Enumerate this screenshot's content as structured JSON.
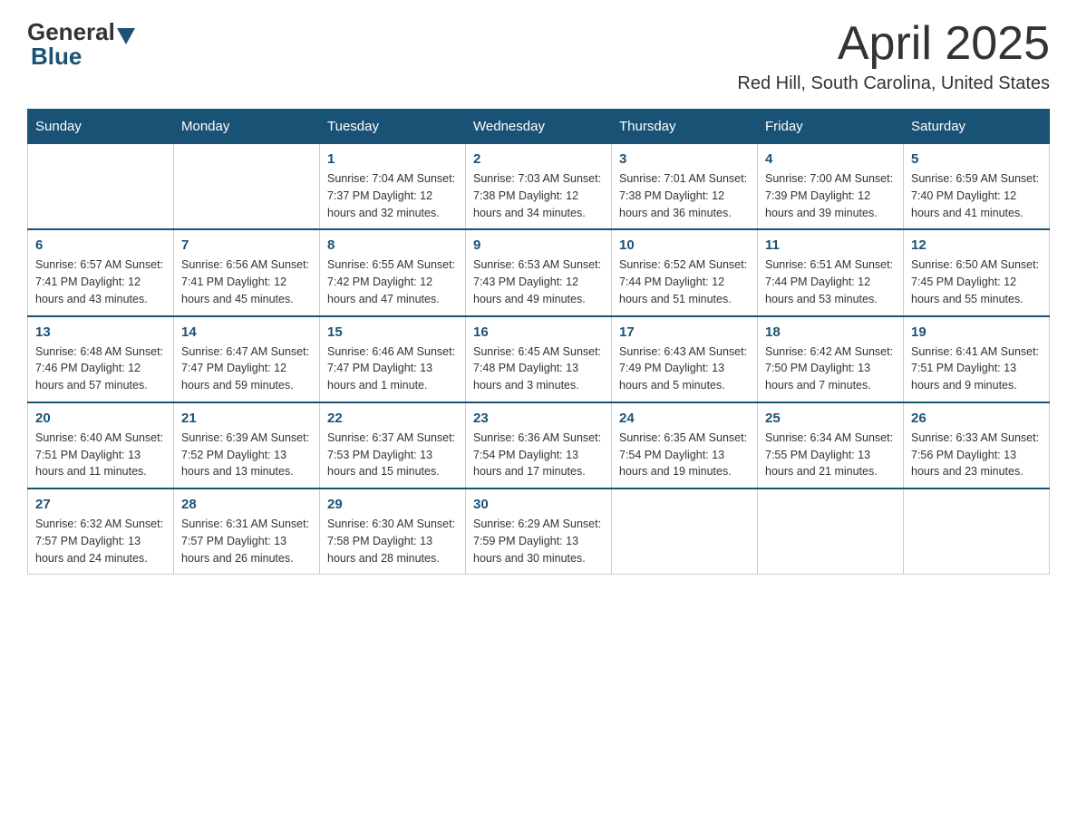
{
  "header": {
    "logo_general": "General",
    "logo_blue": "Blue",
    "title": "April 2025",
    "location": "Red Hill, South Carolina, United States"
  },
  "days_of_week": [
    "Sunday",
    "Monday",
    "Tuesday",
    "Wednesday",
    "Thursday",
    "Friday",
    "Saturday"
  ],
  "weeks": [
    [
      {
        "day": "",
        "info": ""
      },
      {
        "day": "",
        "info": ""
      },
      {
        "day": "1",
        "info": "Sunrise: 7:04 AM\nSunset: 7:37 PM\nDaylight: 12 hours\nand 32 minutes."
      },
      {
        "day": "2",
        "info": "Sunrise: 7:03 AM\nSunset: 7:38 PM\nDaylight: 12 hours\nand 34 minutes."
      },
      {
        "day": "3",
        "info": "Sunrise: 7:01 AM\nSunset: 7:38 PM\nDaylight: 12 hours\nand 36 minutes."
      },
      {
        "day": "4",
        "info": "Sunrise: 7:00 AM\nSunset: 7:39 PM\nDaylight: 12 hours\nand 39 minutes."
      },
      {
        "day": "5",
        "info": "Sunrise: 6:59 AM\nSunset: 7:40 PM\nDaylight: 12 hours\nand 41 minutes."
      }
    ],
    [
      {
        "day": "6",
        "info": "Sunrise: 6:57 AM\nSunset: 7:41 PM\nDaylight: 12 hours\nand 43 minutes."
      },
      {
        "day": "7",
        "info": "Sunrise: 6:56 AM\nSunset: 7:41 PM\nDaylight: 12 hours\nand 45 minutes."
      },
      {
        "day": "8",
        "info": "Sunrise: 6:55 AM\nSunset: 7:42 PM\nDaylight: 12 hours\nand 47 minutes."
      },
      {
        "day": "9",
        "info": "Sunrise: 6:53 AM\nSunset: 7:43 PM\nDaylight: 12 hours\nand 49 minutes."
      },
      {
        "day": "10",
        "info": "Sunrise: 6:52 AM\nSunset: 7:44 PM\nDaylight: 12 hours\nand 51 minutes."
      },
      {
        "day": "11",
        "info": "Sunrise: 6:51 AM\nSunset: 7:44 PM\nDaylight: 12 hours\nand 53 minutes."
      },
      {
        "day": "12",
        "info": "Sunrise: 6:50 AM\nSunset: 7:45 PM\nDaylight: 12 hours\nand 55 minutes."
      }
    ],
    [
      {
        "day": "13",
        "info": "Sunrise: 6:48 AM\nSunset: 7:46 PM\nDaylight: 12 hours\nand 57 minutes."
      },
      {
        "day": "14",
        "info": "Sunrise: 6:47 AM\nSunset: 7:47 PM\nDaylight: 12 hours\nand 59 minutes."
      },
      {
        "day": "15",
        "info": "Sunrise: 6:46 AM\nSunset: 7:47 PM\nDaylight: 13 hours\nand 1 minute."
      },
      {
        "day": "16",
        "info": "Sunrise: 6:45 AM\nSunset: 7:48 PM\nDaylight: 13 hours\nand 3 minutes."
      },
      {
        "day": "17",
        "info": "Sunrise: 6:43 AM\nSunset: 7:49 PM\nDaylight: 13 hours\nand 5 minutes."
      },
      {
        "day": "18",
        "info": "Sunrise: 6:42 AM\nSunset: 7:50 PM\nDaylight: 13 hours\nand 7 minutes."
      },
      {
        "day": "19",
        "info": "Sunrise: 6:41 AM\nSunset: 7:51 PM\nDaylight: 13 hours\nand 9 minutes."
      }
    ],
    [
      {
        "day": "20",
        "info": "Sunrise: 6:40 AM\nSunset: 7:51 PM\nDaylight: 13 hours\nand 11 minutes."
      },
      {
        "day": "21",
        "info": "Sunrise: 6:39 AM\nSunset: 7:52 PM\nDaylight: 13 hours\nand 13 minutes."
      },
      {
        "day": "22",
        "info": "Sunrise: 6:37 AM\nSunset: 7:53 PM\nDaylight: 13 hours\nand 15 minutes."
      },
      {
        "day": "23",
        "info": "Sunrise: 6:36 AM\nSunset: 7:54 PM\nDaylight: 13 hours\nand 17 minutes."
      },
      {
        "day": "24",
        "info": "Sunrise: 6:35 AM\nSunset: 7:54 PM\nDaylight: 13 hours\nand 19 minutes."
      },
      {
        "day": "25",
        "info": "Sunrise: 6:34 AM\nSunset: 7:55 PM\nDaylight: 13 hours\nand 21 minutes."
      },
      {
        "day": "26",
        "info": "Sunrise: 6:33 AM\nSunset: 7:56 PM\nDaylight: 13 hours\nand 23 minutes."
      }
    ],
    [
      {
        "day": "27",
        "info": "Sunrise: 6:32 AM\nSunset: 7:57 PM\nDaylight: 13 hours\nand 24 minutes."
      },
      {
        "day": "28",
        "info": "Sunrise: 6:31 AM\nSunset: 7:57 PM\nDaylight: 13 hours\nand 26 minutes."
      },
      {
        "day": "29",
        "info": "Sunrise: 6:30 AM\nSunset: 7:58 PM\nDaylight: 13 hours\nand 28 minutes."
      },
      {
        "day": "30",
        "info": "Sunrise: 6:29 AM\nSunset: 7:59 PM\nDaylight: 13 hours\nand 30 minutes."
      },
      {
        "day": "",
        "info": ""
      },
      {
        "day": "",
        "info": ""
      },
      {
        "day": "",
        "info": ""
      }
    ]
  ]
}
